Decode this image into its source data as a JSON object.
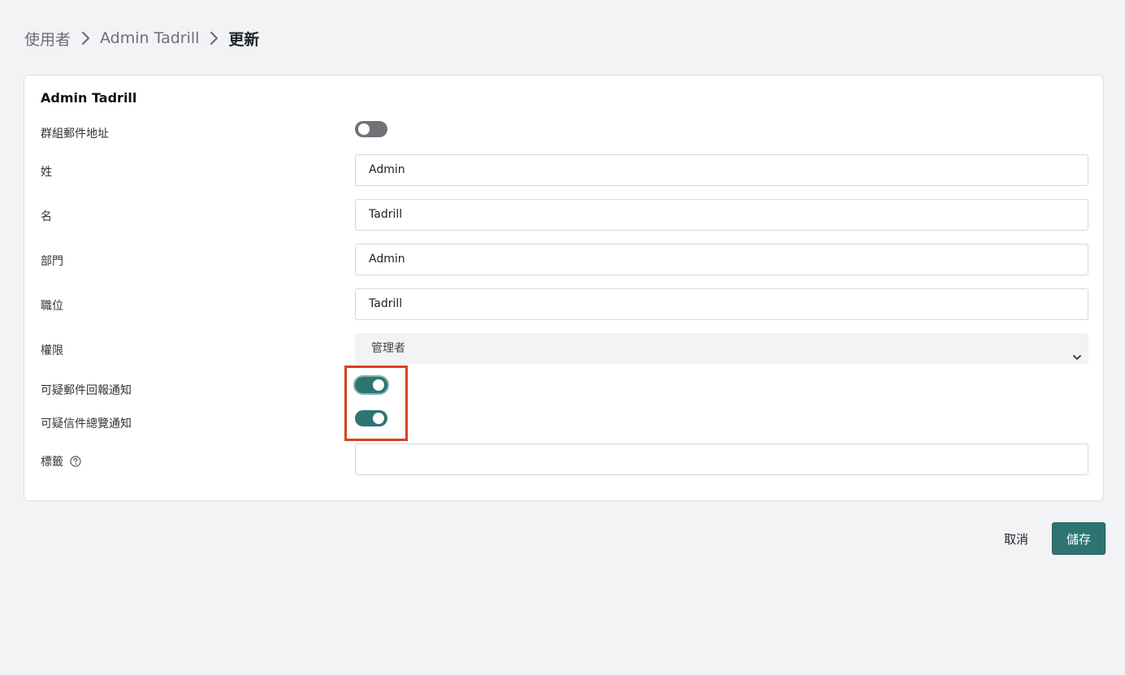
{
  "breadcrumb": {
    "items": [
      "使用者",
      "Admin Tadrill"
    ],
    "current": "更新"
  },
  "card": {
    "title": "Admin Tadrill"
  },
  "form": {
    "group_mail": {
      "label": "群組郵件地址",
      "enabled": false
    },
    "last_name": {
      "label": "姓",
      "value": "Admin"
    },
    "first_name": {
      "label": "名",
      "value": "Tadrill"
    },
    "department": {
      "label": "部門",
      "value": "Admin"
    },
    "position": {
      "label": "職位",
      "value": "Tadrill"
    },
    "permission": {
      "label": "權限",
      "selected": "管理者"
    },
    "suspicious_mail_report": {
      "label": "可疑郵件回報通知",
      "enabled": true
    },
    "suspicious_mail_overview": {
      "label": "可疑信件總覽通知",
      "enabled": true
    },
    "tags": {
      "label": "標籤",
      "value": ""
    }
  },
  "actions": {
    "cancel_label": "取消",
    "save_label": "儲存"
  },
  "colors": {
    "accent": "#2e7472",
    "highlight": "#d9411e",
    "toggle_off": "#6f7276",
    "background": "#f2f3f5"
  },
  "icons": {
    "breadcrumb_separator": "chevron-right-icon",
    "select_arrow": "chevron-down-icon",
    "tags_help": "question-circle-icon"
  }
}
